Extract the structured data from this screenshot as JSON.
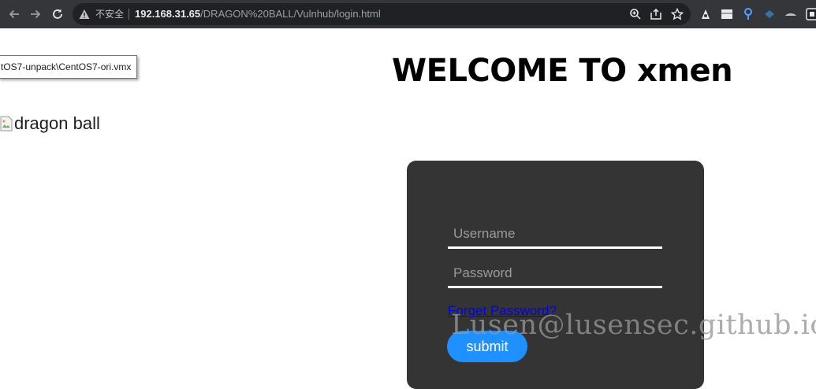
{
  "browser": {
    "security_label": "不安全",
    "url_host": "192.168.31.65",
    "url_path": "/DRAGON%20BALL/Vulnhub/login.html",
    "icons": [
      "back-arrow-icon",
      "forward-arrow-icon",
      "reload-icon",
      "warning-icon",
      "zoom-icon",
      "share-icon",
      "bookmark-star-icon"
    ],
    "extension_icons": [
      "extension-1-icon",
      "extension-2-icon",
      "extension-3-icon",
      "extension-4-icon",
      "extension-5-icon",
      "extension-6-icon"
    ]
  },
  "tooltip": {
    "text": "tOS7-unpack\\CentOS7-ori.vmx"
  },
  "image": {
    "alt": "dragon ball"
  },
  "page": {
    "title": "WELCOME TO xmen"
  },
  "login": {
    "username_placeholder": "Username",
    "password_placeholder": "Password",
    "forgot_label": "Forget Password?",
    "submit_label": "submit"
  },
  "watermark": {
    "text": "Lusen@lusensec.github.io"
  },
  "colors": {
    "toolbar_bg": "#35363a",
    "omnibox_bg": "#202124",
    "card_bg": "#343434",
    "submit_bg": "#1e90ff",
    "link": "#0000ee"
  }
}
